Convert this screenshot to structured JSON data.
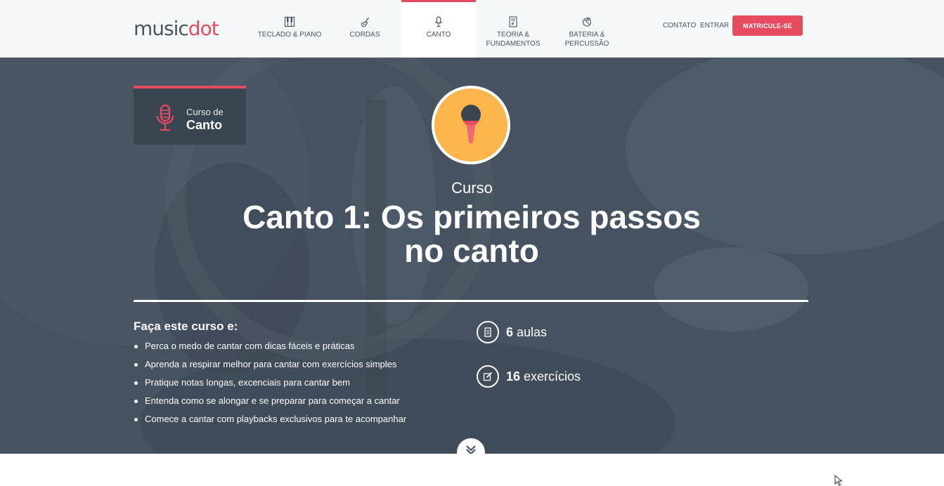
{
  "nav": {
    "logo": {
      "part1": "music",
      "part2": "dot"
    },
    "items": [
      {
        "label": "TECLADO & PIANO",
        "icon": "piano-icon"
      },
      {
        "label": "CORDAS",
        "icon": "guitar-icon"
      },
      {
        "label": "CANTO",
        "icon": "microphone-icon",
        "active": true
      },
      {
        "label": "TEORIA & FUNDAMENTOS",
        "line1": "TEORIA &",
        "line2": "FUNDAMENTOS",
        "icon": "sheet-music-icon"
      },
      {
        "label": "BATERIA & PERCUSSÃO",
        "line1": "BATERIA &",
        "line2": "PERCUSSÃO",
        "icon": "drum-icon"
      }
    ],
    "contact": "CONTATO",
    "login": "ENTRAR",
    "cta": "MATRICULE-SE"
  },
  "hero": {
    "badge": {
      "pre": "Curso de",
      "main": "Canto",
      "icon": "microphone-icon"
    },
    "course_icon": "handheld-microphone-icon",
    "kicker": "Curso",
    "title_line1": "Canto 1: Os primeiros passos",
    "title_line2": "no canto",
    "list_heading": "Faça este curso e:",
    "bullets": [
      "Perca o medo de cantar com dicas fáceis e práticas",
      "Aprenda a respirar melhor para cantar com exercícios simples",
      "Pratique notas longas, excenciais para cantar bem",
      "Entenda como se alongar e se preparar para começar a cantar",
      "Comece a cantar com playbacks exclusivos para te acompanhar"
    ],
    "stats": [
      {
        "number": "6",
        "label": "aulas",
        "icon": "lesson-icon"
      },
      {
        "number": "16",
        "label": "exercícios",
        "icon": "edit-icon"
      }
    ],
    "scroll_icon": "double-chevron-down-icon"
  },
  "colors": {
    "accent": "#e84a5f",
    "hero_bg": "#465260",
    "badge_bg": "#3a4552",
    "course_circle": "#fbb54a",
    "nav_bg": "#f5f8f9"
  }
}
